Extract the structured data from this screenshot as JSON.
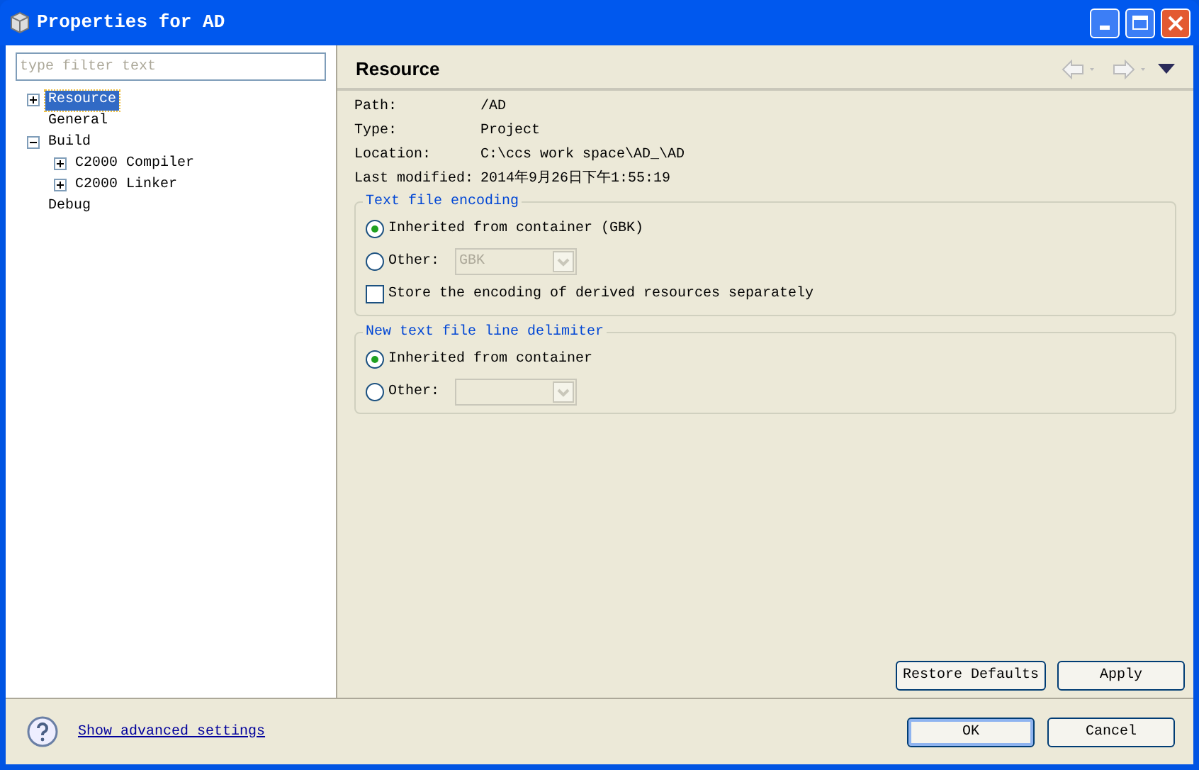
{
  "window": {
    "title": "Properties for AD"
  },
  "filter": {
    "placeholder": "type filter text"
  },
  "tree": [
    {
      "label": "Resource",
      "kind": "folder",
      "expanded": false,
      "selected": true
    },
    {
      "label": "General",
      "kind": "leaf",
      "selected": false
    },
    {
      "label": "Build",
      "kind": "folder",
      "expanded": true,
      "selected": false,
      "children": [
        {
          "label": "C2000 Compiler",
          "kind": "folder",
          "expanded": false,
          "selected": false
        },
        {
          "label": "C2000 Linker",
          "kind": "folder",
          "expanded": false,
          "selected": false
        }
      ]
    },
    {
      "label": "Debug",
      "kind": "leaf",
      "selected": false
    }
  ],
  "page": {
    "title": "Resource",
    "info": [
      {
        "label": "Path:",
        "value": "/AD"
      },
      {
        "label": "Type:",
        "value": "Project"
      },
      {
        "label": "Location:",
        "value": "C:\\ccs work space\\AD_\\AD"
      },
      {
        "label": "Last modified:",
        "value": "2014年9月26日下午1:55:19"
      }
    ],
    "groups": [
      {
        "title": "Text file encoding",
        "options": [
          {
            "kind": "radio",
            "label": "Inherited from container (GBK)",
            "selected": true
          },
          {
            "kind": "radio-combo",
            "label": "Other:",
            "selected": false,
            "value": "GBK"
          },
          {
            "kind": "checkbox",
            "label": "Store the encoding of derived resources separately",
            "checked": false
          }
        ]
      },
      {
        "title": "New text file line delimiter",
        "options": [
          {
            "kind": "radio",
            "label": "Inherited from container",
            "selected": true
          },
          {
            "kind": "radio-combo",
            "label": "Other:",
            "selected": false
          }
        ]
      }
    ],
    "buttons": [
      "Restore Defaults",
      "Apply"
    ]
  },
  "footer": {
    "link": "Show advanced settings",
    "buttons": [
      {
        "label": "OK",
        "default": true
      },
      {
        "label": "Cancel",
        "default": false
      }
    ]
  }
}
